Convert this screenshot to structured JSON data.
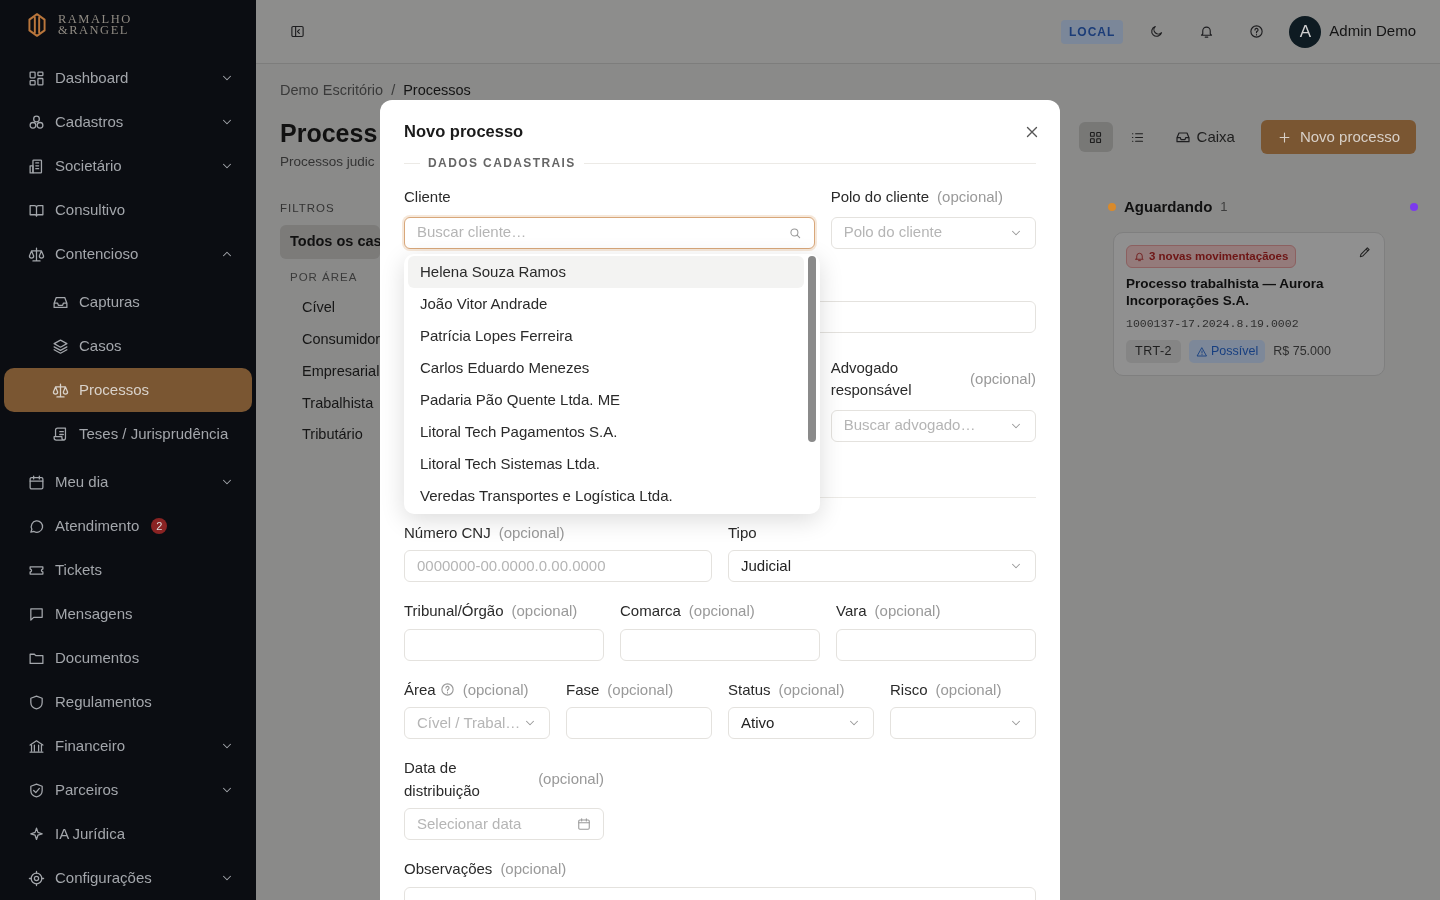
{
  "brand": {
    "line1": "RAMALHO",
    "line2": "&RANGEL"
  },
  "sidebar": {
    "items": [
      {
        "label": "Dashboard",
        "expanded": false
      },
      {
        "label": "Cadastros",
        "expanded": false
      },
      {
        "label": "Societário",
        "expanded": false
      },
      {
        "label": "Consultivo"
      },
      {
        "label": "Contencioso",
        "expanded": true,
        "children": [
          {
            "label": "Capturas",
            "selected": false
          },
          {
            "label": "Casos",
            "selected": false
          },
          {
            "label": "Processos",
            "selected": true
          },
          {
            "label": "Teses / Jurisprudência",
            "selected": false
          }
        ]
      },
      {
        "label": "Meu dia",
        "expanded": false
      },
      {
        "label": "Atendimento",
        "badge": "2"
      },
      {
        "label": "Tickets"
      },
      {
        "label": "Mensagens"
      },
      {
        "label": "Documentos"
      },
      {
        "label": "Regulamentos"
      },
      {
        "label": "Financeiro",
        "expanded": false
      },
      {
        "label": "Parceiros",
        "expanded": false
      },
      {
        "label": "IA Jurídica"
      },
      {
        "label": "Configurações",
        "expanded": false
      }
    ]
  },
  "topbar": {
    "environment": "LOCAL",
    "user": {
      "initial": "A",
      "name": "Admin Demo"
    }
  },
  "breadcrumb": {
    "items": [
      "Demo Escritório",
      "Processos"
    ],
    "separator": "/"
  },
  "page": {
    "title": "Process",
    "subtitle": "Processos judic"
  },
  "toolbar": {
    "views": [
      {
        "kind": "board",
        "selected": true
      },
      {
        "kind": "list",
        "selected": false
      }
    ],
    "inbox": "Caixa",
    "new_button": "Novo processo"
  },
  "filters": {
    "heading": "FILTROS",
    "all": {
      "label": "Todos os cas",
      "selected": true
    },
    "area_heading": "POR ÁREA",
    "areas": [
      {
        "label": "Cível",
        "selected": false
      },
      {
        "label": "Consumidor",
        "selected": false
      },
      {
        "label": "Empresarial",
        "selected": false
      },
      {
        "label": "Trabalhista",
        "selected": false
      },
      {
        "label": "Tributário",
        "selected": false
      }
    ]
  },
  "board": {
    "columns": [
      {
        "title": "Aguardando",
        "count": "1",
        "color": "#d98a2b",
        "cards": [
          {
            "alert": "3 novas movimentaçãoes",
            "title": "Processo trabalhista — Aurora Incorporações S.A.",
            "number": "1000137-17.2024.8.19.0002",
            "court": "TRT-2",
            "risk": "Possível",
            "value": "R$ 75.000"
          }
        ]
      },
      {
        "color": "#7c3aed"
      }
    ]
  },
  "modal": {
    "title": "Novo processo",
    "sections": [
      {
        "heading": "DADOS CADASTRAIS",
        "rows": [
          {
            "kind": "split",
            "fields": [
              {
                "label": "Cliente",
                "kind": "combobox",
                "placeholder": "Buscar cliente…",
                "focused": true,
                "options": [
                  {
                    "label": "Helena Souza Ramos",
                    "highlighted": true
                  },
                  {
                    "label": "João Vitor Andrade",
                    "highlighted": false
                  },
                  {
                    "label": "Patrícia Lopes Ferreira",
                    "highlighted": false
                  },
                  {
                    "label": "Carlos Eduardo Menezes",
                    "highlighted": false
                  },
                  {
                    "label": "Padaria Pão Quente Ltda. ME",
                    "highlighted": false
                  },
                  {
                    "label": "Litoral Tech Pagamentos S.A.",
                    "highlighted": false
                  },
                  {
                    "label": "Litoral Tech Sistemas Ltda.",
                    "highlighted": false
                  },
                  {
                    "label": "Veredas Transportes e Logística Ltda.",
                    "highlighted": false
                  }
                ]
              },
              {
                "label": "Polo do cliente",
                "note": "(opcional)",
                "kind": "select",
                "placeholder": "Polo do cliente"
              }
            ]
          },
          {
            "kind": "single",
            "fields": [
              {
                "kind": "input"
              }
            ]
          },
          {
            "kind": "aside",
            "fields": [
              {
                "label": "Advogado responsável",
                "note": "(opcional)",
                "kind": "select",
                "placeholder": "Buscar advogado…"
              }
            ]
          }
        ]
      },
      {
        "rows": [
          {
            "kind": "pair",
            "fields": [
              {
                "label": "Número CNJ",
                "note": "(opcional)",
                "kind": "input",
                "placeholder": "0000000-00.0000.0.00.0000"
              },
              {
                "label": "Tipo",
                "kind": "select",
                "value": "Judicial"
              }
            ]
          },
          {
            "kind": "triple",
            "fields": [
              {
                "label": "Tribunal/Órgão",
                "note": "(opcional)",
                "kind": "input"
              },
              {
                "label": "Comarca",
                "note": "(opcional)",
                "kind": "input"
              },
              {
                "label": "Vara",
                "note": "(opcional)",
                "kind": "input"
              }
            ]
          },
          {
            "kind": "quad",
            "fields": [
              {
                "label": "Área",
                "note": "(opcional)",
                "help": true,
                "kind": "select",
                "placeholder": "Cível / Trabal…"
              },
              {
                "label": "Fase",
                "note": "(opcional)",
                "kind": "input"
              },
              {
                "label": "Status",
                "note": "(opcional)",
                "kind": "select",
                "value": "Ativo"
              },
              {
                "label": "Risco",
                "note": "(opcional)",
                "kind": "select"
              }
            ]
          },
          {
            "kind": "third",
            "fields": [
              {
                "label": "Data de distribuição",
                "note": "(opcional)",
                "kind": "date",
                "placeholder": "Selecionar data"
              }
            ]
          },
          {
            "kind": "single",
            "fields": [
              {
                "label": "Observações",
                "note": "(opcional)",
                "kind": "textarea"
              }
            ]
          }
        ]
      }
    ]
  }
}
